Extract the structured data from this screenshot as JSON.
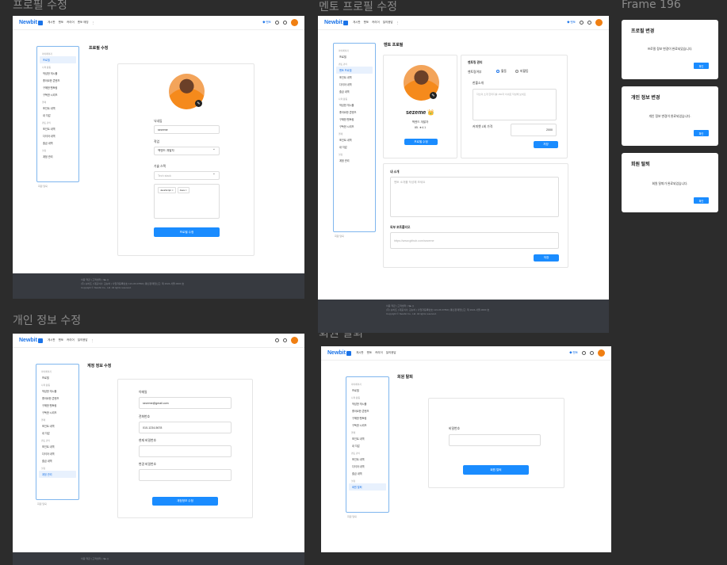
{
  "frame_titles": {
    "profile_edit": "프로필 수정",
    "mentor_profile_edit": "멘토 프로필 수정",
    "frame196": "Frame 196",
    "personal_info_edit": "개인 정보 수정",
    "withdrawal": "회원 탈퇴"
  },
  "brand": {
    "logo": "Newbit",
    "accent": "#1a8cff",
    "footer_bg": "#373a40"
  },
  "nav": {
    "links": [
      "게시판",
      "멘토",
      "커리어",
      "멘토 매칭",
      "질의응답",
      "⋮"
    ],
    "mentor_badge": "◆ 멘토"
  },
  "sidebar": {
    "group1": "마이페이지",
    "profile": "프로필",
    "group2": "나의 활동",
    "items_a": [
      "작성한 게시물",
      "좋아요한 콘텐츠",
      "구매한 멘토링",
      "구독한 시리즈"
    ],
    "group3": "결제",
    "items_b": [
      "포인트 내역",
      "내 지갑"
    ],
    "group4": "멘토 관리",
    "items_c": [
      "포인트 내역",
      "다이아 내역",
      "출금 내역"
    ],
    "group5": "설정",
    "account": "계정 관리",
    "under": "회원 탈퇴"
  },
  "profile_edit": {
    "heading": "프로필 수정",
    "nickname_label": "닉네임",
    "nickname_value": "sezeme",
    "job_label": "직업",
    "job_value": "백엔드 개발자",
    "skill_label": "기술 스택",
    "skill_value": "Tech stack",
    "tags": [
      "JavaScript ×",
      "Java ×"
    ],
    "submit": "프로필 수정"
  },
  "mentor_profile": {
    "heading": "멘토 프로필",
    "name": "sezeme 👑",
    "job": "백엔드 개발자",
    "stats": "85.  ★4.1",
    "edit_btn": "프로필 수정",
    "settings_title": "멘토링 관리",
    "mentoring_label": "멘토링여부",
    "opt_on": "활동",
    "opt_off": "비활동",
    "intro_label": "한줄소개",
    "intro_ph": "자신의 소개 한마디를 150자 이내로 작성해 보세요",
    "price_label": "커피챗 1회 가격",
    "price_value": "2000",
    "save1": "저장",
    "about_title": "내 소개",
    "about_ph": "멘토 소개를 작성해 보세요",
    "link_title": "외부 포트폴리오",
    "link_ph": "https://www.github.com/sezeme",
    "save2": "저장"
  },
  "personal_info": {
    "heading": "계정 정보 수정",
    "email_label": "이메일",
    "email_value": "sezeme@gmail.com",
    "phone_label": "전화번호",
    "phone_value": "010-1234-5678",
    "pw_label": "현재 비밀번호",
    "newpw_label": "변경 비밀번호",
    "submit": "계정정보 수정"
  },
  "withdraw": {
    "heading": "회원 탈퇴",
    "pw_label": "비밀번호",
    "submit": "회원 탈퇴"
  },
  "dialogs": [
    {
      "title": "프로필 변경",
      "message": "프로필 정보 변경이 완료되었습니다.",
      "button": "확인"
    },
    {
      "title": "개인 정보 변경",
      "message": "개인 정보 변경이 완료되었습니다.",
      "button": "확인"
    },
    {
      "title": "회원 탈퇴",
      "message": "회원 탈퇴가 완료되었습니다.",
      "button": "확인"
    }
  ],
  "footer": {
    "links": "이용 약관 | 고객센터 | f ▶ ◎",
    "line1": "(주) 뉴비트 | 대표이사: 김뉴비 | 사업자등록번호 123-45-67890 | 통신판매업신고: 제 2024-서울-0000 호",
    "line2": "Copyright © Newbit Co., Ltd. All rights reserved."
  }
}
